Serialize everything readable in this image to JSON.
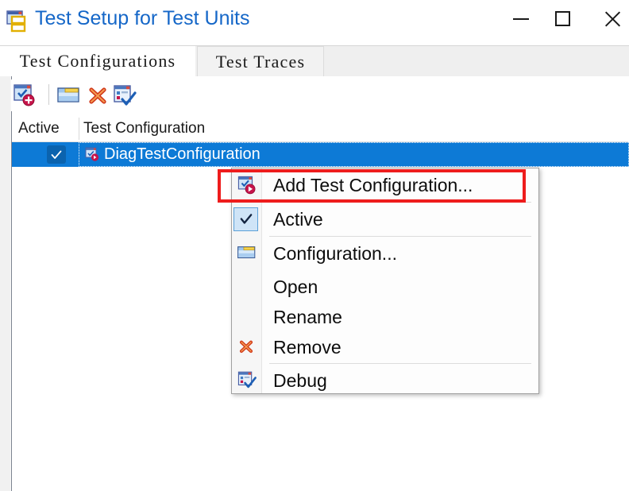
{
  "window": {
    "title": "Test Setup for Test Units",
    "icon": "test-units-icon",
    "title_color": "#1567c8",
    "controls": {
      "minimize": "minimize-icon",
      "maximize": "maximize-icon",
      "close": "close-icon"
    }
  },
  "tabs": [
    {
      "label": "Test Configurations",
      "active": true
    },
    {
      "label": "Test Traces",
      "active": false
    }
  ],
  "toolbar": {
    "buttons": [
      {
        "name": "add-test-configuration",
        "icon": "add-config-icon"
      },
      {
        "name": "configuration",
        "icon": "folder-icon"
      },
      {
        "name": "remove",
        "icon": "red-x-icon"
      },
      {
        "name": "debug",
        "icon": "debug-check-icon"
      }
    ]
  },
  "list": {
    "columns": [
      "Active",
      "Test Configuration"
    ],
    "rows": [
      {
        "active": true,
        "checkmark": "✓",
        "name": "DiagTestConfiguration",
        "icon": "config-item-icon",
        "selected": true,
        "selection_color": "#0d7ad6"
      }
    ]
  },
  "context_menu": {
    "highlight_color": "#ee1c1c",
    "items": [
      {
        "label": "Add Test Configuration...",
        "icon": "add-config-icon",
        "highlighted": true,
        "separator_after": true
      },
      {
        "label": "Active",
        "icon": "checkmark-icon",
        "checked": true,
        "separator_after": true
      },
      {
        "label": "Configuration...",
        "icon": "folder-icon",
        "separator_after": false
      },
      {
        "label": "Open",
        "icon": "",
        "separator_after": false
      },
      {
        "label": "Rename",
        "icon": "",
        "separator_after": false
      },
      {
        "label": "Remove",
        "icon": "red-x-icon",
        "separator_after": true
      },
      {
        "label": "Debug",
        "icon": "debug-check-icon",
        "separator_after": false
      }
    ]
  }
}
